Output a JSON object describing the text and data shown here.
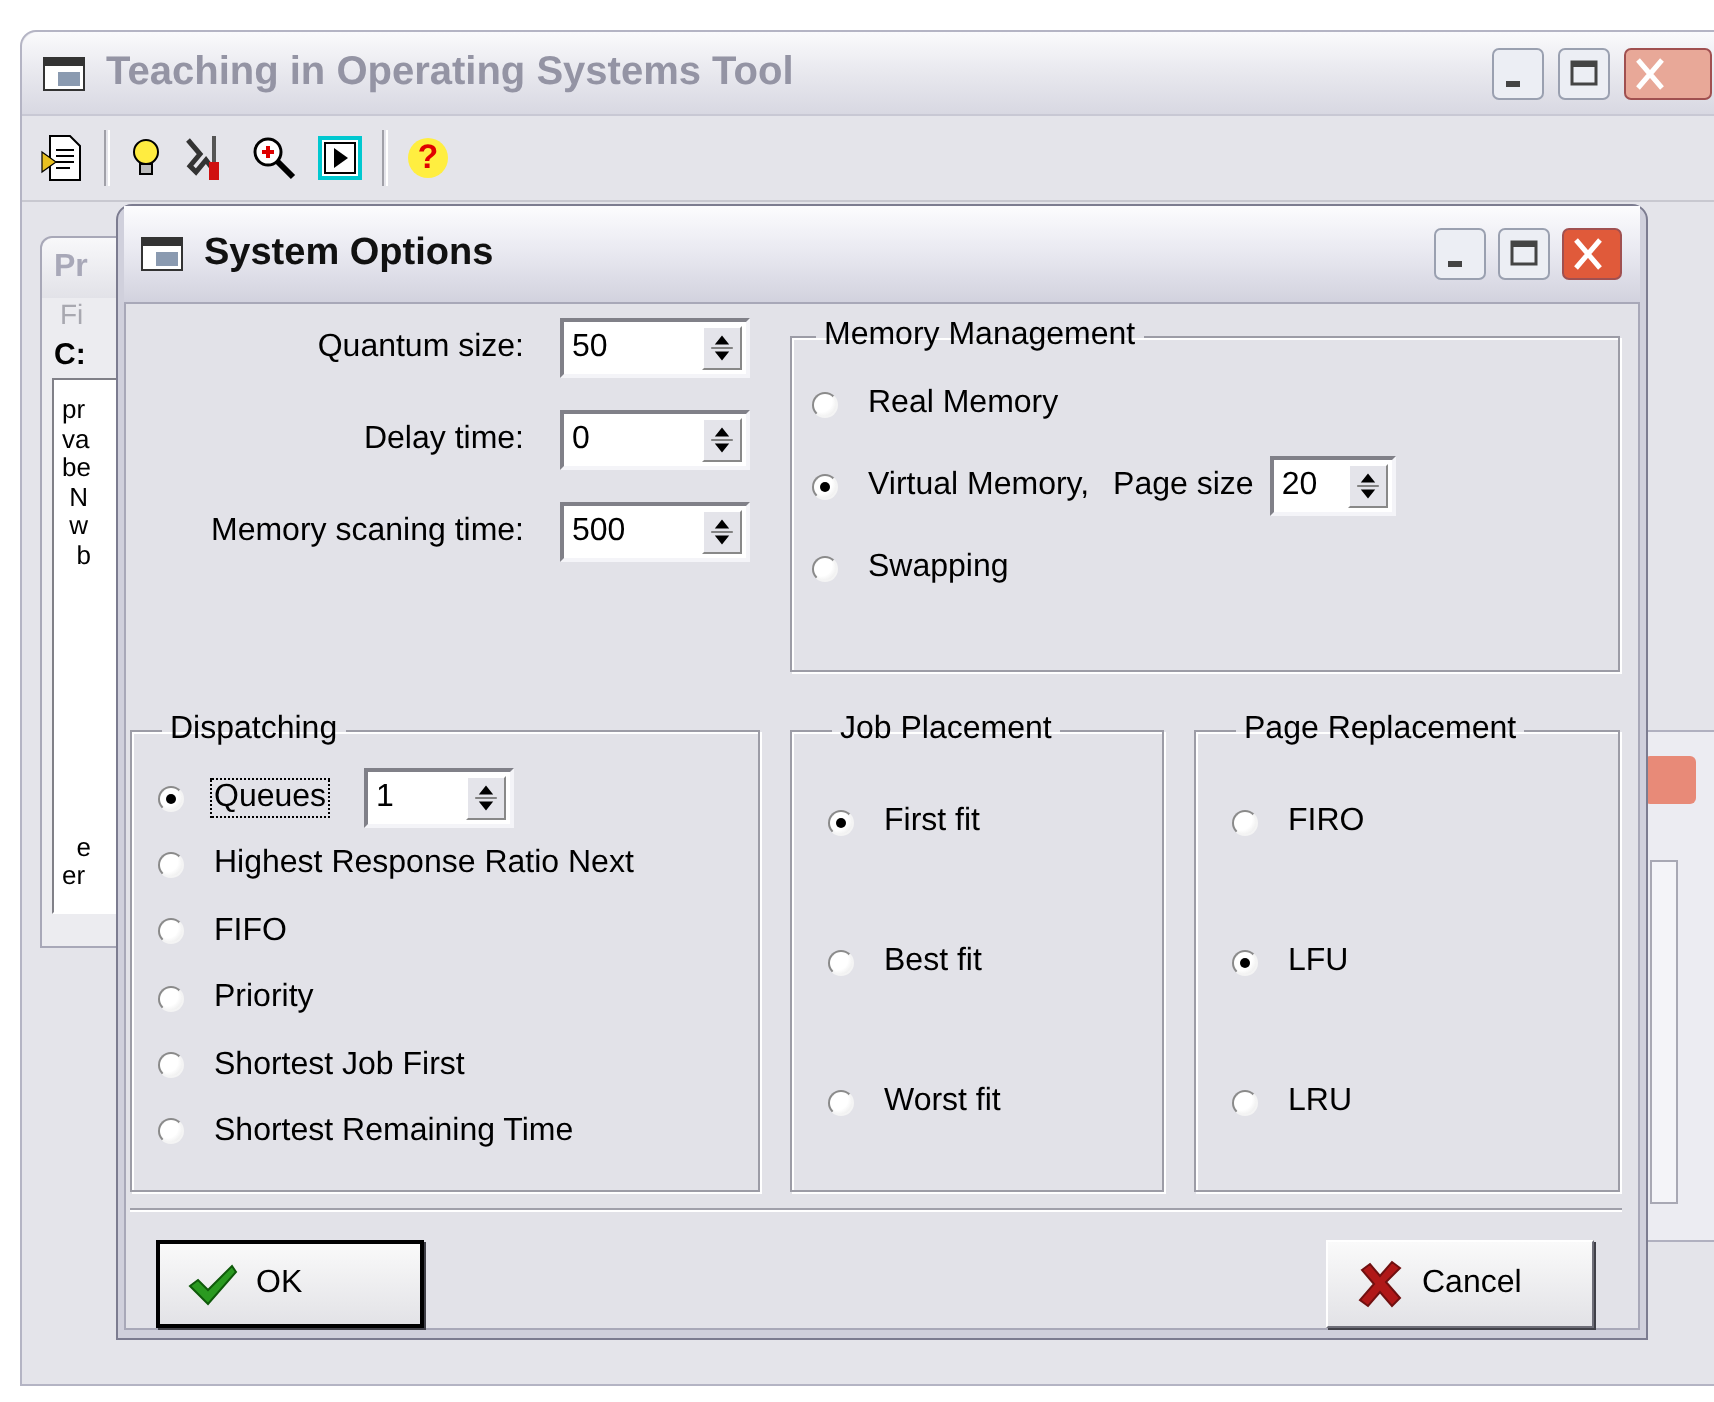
{
  "main_window": {
    "title": "Teaching in Operating Systems Tool",
    "active": false,
    "toolbar": [
      {
        "kind": "document"
      },
      {
        "kind": "separator"
      },
      {
        "kind": "lightbulb"
      },
      {
        "kind": "tools"
      },
      {
        "kind": "zoom"
      },
      {
        "kind": "play"
      },
      {
        "kind": "separator"
      },
      {
        "kind": "help",
        "glyph": "?"
      }
    ],
    "child_window": {
      "title": "Pr",
      "menu": "Fi",
      "path": "C:",
      "lines": [
        "pr",
        "va",
        "be",
        " N",
        " w",
        "  b"
      ],
      "lower_lines": [
        "  e",
        "er"
      ]
    }
  },
  "dialog": {
    "title": "System Options",
    "active": true,
    "fields": [
      {
        "label": "Quantum size:",
        "value": "50"
      },
      {
        "label": "Delay time:",
        "value": "0"
      },
      {
        "label": "Memory scaning time:",
        "value": "500"
      }
    ],
    "memory_management": {
      "title": "Memory Management",
      "options": [
        {
          "label": "Real Memory",
          "selected": false,
          "focused": false
        },
        {
          "label": "Virtual Memory,",
          "selected": true,
          "focused": false,
          "field": {
            "label": "Page size",
            "value": "20"
          }
        },
        {
          "label": "Swapping",
          "selected": false,
          "focused": false
        }
      ]
    },
    "dispatching": {
      "title": "Dispatching",
      "options": [
        {
          "label": "Queues",
          "selected": true,
          "focused": true,
          "field": {
            "value": "1"
          }
        },
        {
          "label": "Highest Response Ratio Next",
          "selected": false,
          "focused": false
        },
        {
          "label": "FIFO",
          "selected": false,
          "focused": false
        },
        {
          "label": "Priority",
          "selected": false,
          "focused": false
        },
        {
          "label": "Shortest Job First",
          "selected": false,
          "focused": false
        },
        {
          "label": "Shortest Remaining Time",
          "selected": false,
          "focused": false
        }
      ]
    },
    "job_placement": {
      "title": "Job Placement",
      "options": [
        {
          "label": "First fit",
          "selected": true,
          "focused": false
        },
        {
          "label": "Best fit",
          "selected": false,
          "focused": false
        },
        {
          "label": "Worst fit",
          "selected": false,
          "focused": false
        }
      ]
    },
    "page_replacement": {
      "title": "Page Replacement",
      "options": [
        {
          "label": "FIRO",
          "selected": false,
          "focused": false
        },
        {
          "label": "LFU",
          "selected": true,
          "focused": false
        },
        {
          "label": "LRU",
          "selected": false,
          "focused": false
        }
      ]
    },
    "buttons": [
      {
        "kind": "ok",
        "label": "OK",
        "default": true
      },
      {
        "kind": "cancel",
        "label": "Cancel",
        "default": false
      }
    ]
  }
}
